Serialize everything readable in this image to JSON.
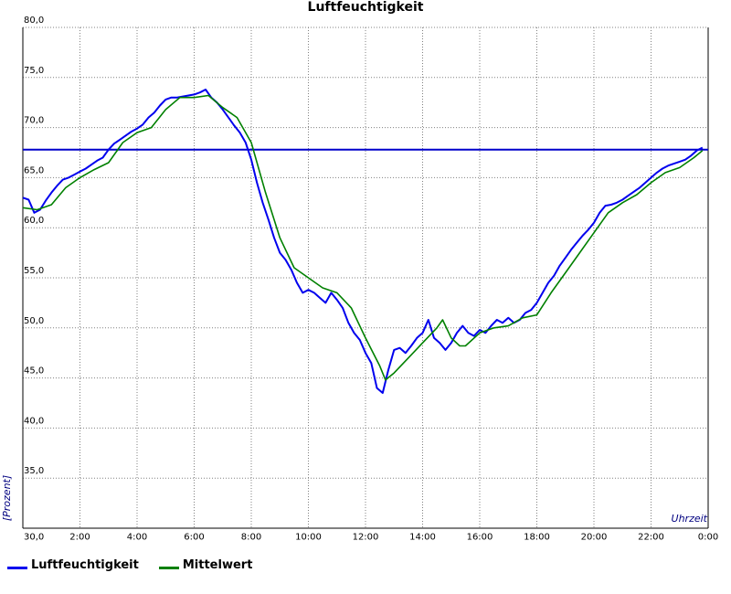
{
  "chart_data": {
    "type": "line",
    "title": "Luftfeuchtigkeit",
    "xlabel": "Uhrzeit",
    "ylabel": "[Prozent]",
    "x_unit": "hours",
    "xlim": [
      0,
      24
    ],
    "ylim": [
      30,
      80
    ],
    "x_ticks": [
      {
        "x": 2,
        "label": "2:00"
      },
      {
        "x": 4,
        "label": "4:00"
      },
      {
        "x": 6,
        "label": "6:00"
      },
      {
        "x": 8,
        "label": "8:00"
      },
      {
        "x": 10,
        "label": "10:00"
      },
      {
        "x": 12,
        "label": "12:00"
      },
      {
        "x": 14,
        "label": "14:00"
      },
      {
        "x": 16,
        "label": "16:00"
      },
      {
        "x": 18,
        "label": "18:00"
      },
      {
        "x": 20,
        "label": "20:00"
      },
      {
        "x": 22,
        "label": "22:00"
      },
      {
        "x": 24,
        "label": "0:00"
      }
    ],
    "y_ticks": [
      {
        "y": 30,
        "label": "30,0"
      },
      {
        "y": 35,
        "label": "35,0"
      },
      {
        "y": 40,
        "label": "40,0"
      },
      {
        "y": 45,
        "label": "45,0"
      },
      {
        "y": 50,
        "label": "50,0"
      },
      {
        "y": 55,
        "label": "55,0"
      },
      {
        "y": 60,
        "label": "60,0"
      },
      {
        "y": 65,
        "label": "65,0"
      },
      {
        "y": 70,
        "label": "70,0"
      },
      {
        "y": 75,
        "label": "75,0"
      },
      {
        "y": 80,
        "label": "80,0"
      }
    ],
    "grid": true,
    "legend_position": "bottom-left",
    "reference_line": {
      "y": 67.8,
      "color": "#0000cc"
    },
    "series": [
      {
        "name": "Luftfeuchtigkeit",
        "color": "#0000ee",
        "points": [
          [
            0.0,
            63.0
          ],
          [
            0.2,
            62.8
          ],
          [
            0.4,
            61.5
          ],
          [
            0.6,
            61.8
          ],
          [
            0.8,
            62.7
          ],
          [
            1.0,
            63.5
          ],
          [
            1.2,
            64.2
          ],
          [
            1.4,
            64.8
          ],
          [
            1.6,
            65.0
          ],
          [
            1.8,
            65.3
          ],
          [
            2.0,
            65.6
          ],
          [
            2.2,
            65.9
          ],
          [
            2.4,
            66.3
          ],
          [
            2.6,
            66.7
          ],
          [
            2.8,
            67.0
          ],
          [
            3.0,
            67.8
          ],
          [
            3.2,
            68.4
          ],
          [
            3.4,
            68.8
          ],
          [
            3.6,
            69.2
          ],
          [
            3.8,
            69.6
          ],
          [
            4.0,
            69.9
          ],
          [
            4.2,
            70.3
          ],
          [
            4.4,
            71.0
          ],
          [
            4.6,
            71.5
          ],
          [
            4.8,
            72.2
          ],
          [
            5.0,
            72.8
          ],
          [
            5.2,
            73.0
          ],
          [
            5.4,
            73.0
          ],
          [
            5.6,
            73.1
          ],
          [
            5.8,
            73.2
          ],
          [
            6.0,
            73.3
          ],
          [
            6.2,
            73.5
          ],
          [
            6.4,
            73.8
          ],
          [
            6.6,
            73.0
          ],
          [
            6.8,
            72.5
          ],
          [
            7.0,
            71.8
          ],
          [
            7.2,
            71.0
          ],
          [
            7.4,
            70.2
          ],
          [
            7.6,
            69.5
          ],
          [
            7.8,
            68.5
          ],
          [
            8.0,
            66.8
          ],
          [
            8.2,
            64.5
          ],
          [
            8.4,
            62.5
          ],
          [
            8.6,
            60.8
          ],
          [
            8.8,
            59.0
          ],
          [
            9.0,
            57.5
          ],
          [
            9.2,
            56.8
          ],
          [
            9.4,
            55.8
          ],
          [
            9.6,
            54.5
          ],
          [
            9.8,
            53.5
          ],
          [
            10.0,
            53.8
          ],
          [
            10.2,
            53.5
          ],
          [
            10.4,
            53.0
          ],
          [
            10.6,
            52.5
          ],
          [
            10.8,
            53.5
          ],
          [
            11.0,
            52.8
          ],
          [
            11.2,
            52.0
          ],
          [
            11.4,
            50.5
          ],
          [
            11.6,
            49.5
          ],
          [
            11.8,
            48.8
          ],
          [
            12.0,
            47.5
          ],
          [
            12.2,
            46.5
          ],
          [
            12.4,
            44.0
          ],
          [
            12.6,
            43.5
          ],
          [
            12.8,
            45.8
          ],
          [
            13.0,
            47.8
          ],
          [
            13.2,
            48.0
          ],
          [
            13.4,
            47.5
          ],
          [
            13.6,
            48.2
          ],
          [
            13.8,
            49.0
          ],
          [
            14.0,
            49.5
          ],
          [
            14.2,
            50.8
          ],
          [
            14.4,
            49.0
          ],
          [
            14.6,
            48.5
          ],
          [
            14.8,
            47.8
          ],
          [
            15.0,
            48.5
          ],
          [
            15.2,
            49.5
          ],
          [
            15.4,
            50.2
          ],
          [
            15.6,
            49.5
          ],
          [
            15.8,
            49.2
          ],
          [
            16.0,
            49.8
          ],
          [
            16.2,
            49.5
          ],
          [
            16.4,
            50.2
          ],
          [
            16.6,
            50.8
          ],
          [
            16.8,
            50.5
          ],
          [
            17.0,
            51.0
          ],
          [
            17.2,
            50.5
          ],
          [
            17.4,
            50.8
          ],
          [
            17.6,
            51.5
          ],
          [
            17.8,
            51.8
          ],
          [
            18.0,
            52.5
          ],
          [
            18.2,
            53.5
          ],
          [
            18.4,
            54.5
          ],
          [
            18.6,
            55.2
          ],
          [
            18.8,
            56.2
          ],
          [
            19.0,
            57.0
          ],
          [
            19.2,
            57.8
          ],
          [
            19.4,
            58.5
          ],
          [
            19.6,
            59.2
          ],
          [
            19.8,
            59.8
          ],
          [
            20.0,
            60.5
          ],
          [
            20.2,
            61.5
          ],
          [
            20.4,
            62.2
          ],
          [
            20.6,
            62.3
          ],
          [
            20.8,
            62.5
          ],
          [
            21.0,
            62.8
          ],
          [
            21.2,
            63.2
          ],
          [
            21.4,
            63.6
          ],
          [
            21.6,
            64.0
          ],
          [
            21.8,
            64.5
          ],
          [
            22.0,
            65.0
          ],
          [
            22.2,
            65.5
          ],
          [
            22.4,
            65.9
          ],
          [
            22.6,
            66.2
          ],
          [
            22.8,
            66.4
          ],
          [
            23.0,
            66.6
          ],
          [
            23.2,
            66.8
          ],
          [
            23.4,
            67.2
          ],
          [
            23.6,
            67.7
          ],
          [
            23.8,
            68.0
          ]
        ]
      },
      {
        "name": "Mittelwert",
        "color": "#008000",
        "points": [
          [
            0.0,
            62.0
          ],
          [
            0.5,
            61.8
          ],
          [
            1.0,
            62.3
          ],
          [
            1.5,
            64.0
          ],
          [
            2.0,
            65.0
          ],
          [
            2.5,
            65.8
          ],
          [
            3.0,
            66.5
          ],
          [
            3.5,
            68.5
          ],
          [
            4.0,
            69.5
          ],
          [
            4.5,
            70.0
          ],
          [
            5.0,
            71.8
          ],
          [
            5.5,
            73.0
          ],
          [
            6.0,
            73.0
          ],
          [
            6.5,
            73.2
          ],
          [
            7.0,
            72.0
          ],
          [
            7.5,
            71.0
          ],
          [
            8.0,
            68.5
          ],
          [
            8.5,
            63.5
          ],
          [
            9.0,
            59.0
          ],
          [
            9.5,
            56.0
          ],
          [
            10.0,
            55.0
          ],
          [
            10.5,
            54.0
          ],
          [
            11.0,
            53.5
          ],
          [
            11.5,
            52.0
          ],
          [
            12.0,
            49.0
          ],
          [
            12.5,
            46.2
          ],
          [
            12.7,
            44.8
          ],
          [
            13.0,
            45.5
          ],
          [
            13.5,
            47.0
          ],
          [
            14.0,
            48.5
          ],
          [
            14.5,
            50.0
          ],
          [
            14.7,
            50.8
          ],
          [
            15.0,
            49.0
          ],
          [
            15.3,
            48.2
          ],
          [
            15.5,
            48.2
          ],
          [
            16.0,
            49.5
          ],
          [
            16.5,
            50.0
          ],
          [
            17.0,
            50.2
          ],
          [
            17.5,
            51.0
          ],
          [
            18.0,
            51.3
          ],
          [
            18.5,
            53.5
          ],
          [
            19.0,
            55.5
          ],
          [
            19.5,
            57.5
          ],
          [
            20.0,
            59.5
          ],
          [
            20.5,
            61.5
          ],
          [
            21.0,
            62.5
          ],
          [
            21.5,
            63.3
          ],
          [
            22.0,
            64.5
          ],
          [
            22.5,
            65.5
          ],
          [
            23.0,
            66.0
          ],
          [
            23.5,
            67.0
          ],
          [
            23.8,
            67.7
          ]
        ]
      }
    ]
  }
}
